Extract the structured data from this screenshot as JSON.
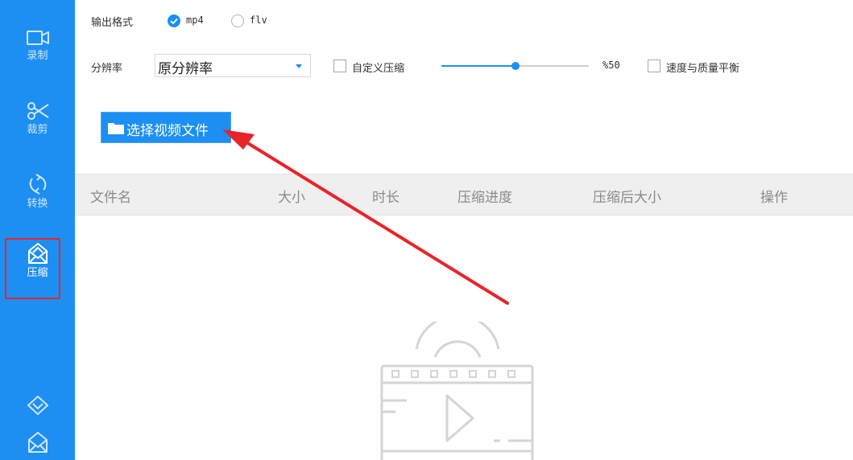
{
  "sidebar": {
    "items": [
      {
        "label": "录制",
        "icon": "video-camera-icon"
      },
      {
        "label": "裁剪",
        "icon": "scissors-icon"
      },
      {
        "label": "转换",
        "icon": "refresh-icon"
      },
      {
        "label": "压缩",
        "icon": "envelope-icon",
        "active": true
      }
    ],
    "bottom_icons": [
      "diamond-icon",
      "envelope-icon"
    ]
  },
  "output_format": {
    "label": "输出格式",
    "options": [
      {
        "label": "mp4",
        "checked": true
      },
      {
        "label": "flv",
        "checked": false
      }
    ]
  },
  "resolution": {
    "label": "分辨率",
    "value": "原分辨率"
  },
  "custom_compress": {
    "label": "自定义压缩",
    "checked": false,
    "slider_percent": 50,
    "slider_text": "%50"
  },
  "balance": {
    "label": "速度与质量平衡",
    "checked": false
  },
  "select_button": {
    "label": "选择视频文件"
  },
  "table": {
    "columns": [
      "文件名",
      "大小",
      "时长",
      "压缩进度",
      "压缩后大小",
      "操作"
    ]
  },
  "colors": {
    "accent": "#1e8ff2",
    "sidebar": "#1e8ff2",
    "annotation": "#e8242a"
  }
}
